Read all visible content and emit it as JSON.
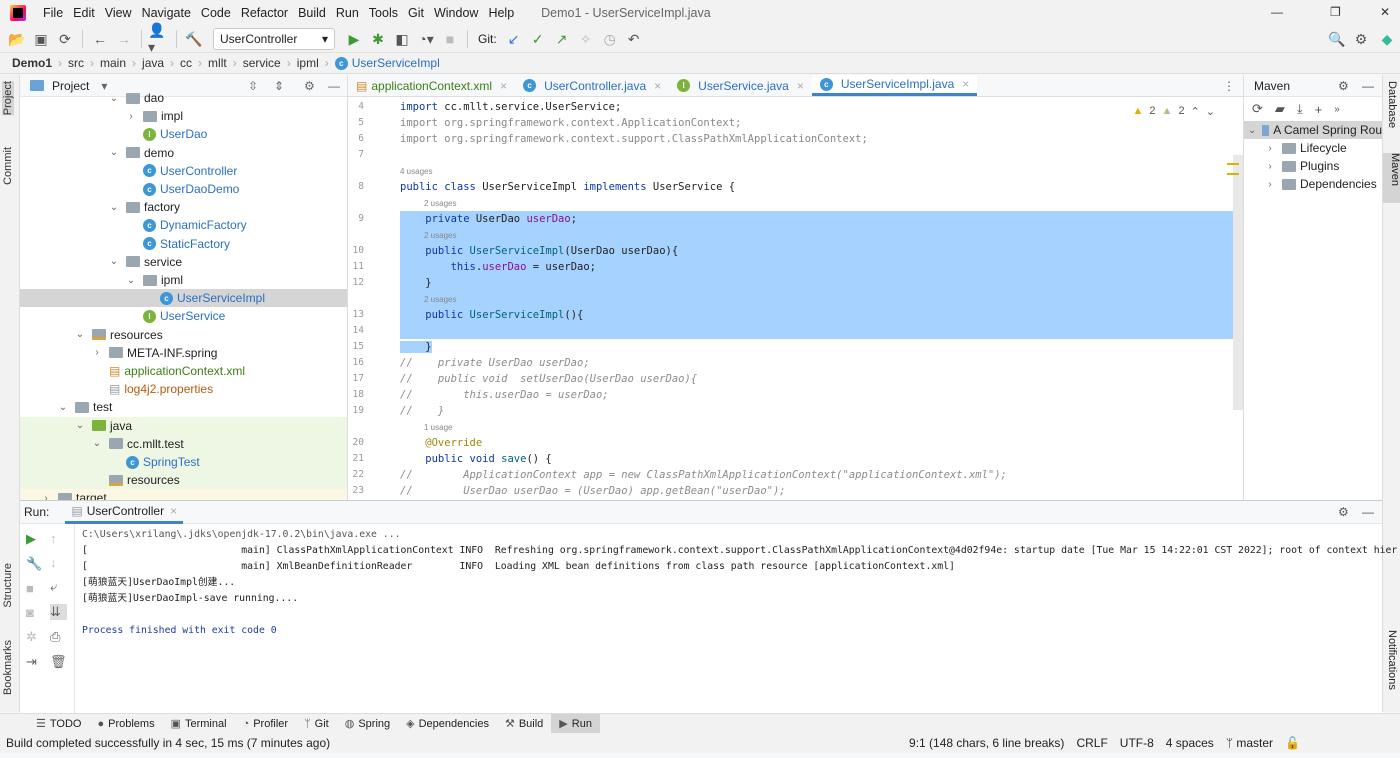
{
  "menu": {
    "items": [
      "File",
      "Edit",
      "View",
      "Navigate",
      "Code",
      "Refactor",
      "Build",
      "Run",
      "Tools",
      "Git",
      "Window",
      "Help"
    ],
    "title": "Demo1 - UserServiceImpl.java"
  },
  "toolbar": {
    "run_config": "UserController",
    "git_label": "Git:"
  },
  "breadcrumb": [
    "Demo1",
    "src",
    "main",
    "java",
    "cc",
    "mllt",
    "service",
    "ipml",
    "UserServiceImpl"
  ],
  "left_stripe": {
    "project": "Project",
    "commit": "Commit",
    "structure": "Structure",
    "bookmarks": "Bookmarks"
  },
  "project": {
    "title": "Project",
    "tree": [
      {
        "label": "dao",
        "type": "folder",
        "level": 5,
        "expanded": true
      },
      {
        "label": "impl",
        "type": "folder",
        "level": 6,
        "expanded": false
      },
      {
        "label": "UserDao",
        "type": "interface",
        "level": 6
      },
      {
        "label": "demo",
        "type": "folder",
        "level": 5,
        "expanded": true
      },
      {
        "label": "UserController",
        "type": "class",
        "level": 6
      },
      {
        "label": "UserDaoDemo",
        "type": "class",
        "level": 6
      },
      {
        "label": "factory",
        "type": "folder",
        "level": 5,
        "expanded": true
      },
      {
        "label": "DynamicFactory",
        "type": "class",
        "level": 6
      },
      {
        "label": "StaticFactory",
        "type": "class",
        "level": 6
      },
      {
        "label": "service",
        "type": "folder",
        "level": 5,
        "expanded": true
      },
      {
        "label": "ipml",
        "type": "folder",
        "level": 6,
        "expanded": true
      },
      {
        "label": "UserServiceImpl",
        "type": "class",
        "level": 7,
        "selected": true
      },
      {
        "label": "UserService",
        "type": "interface",
        "level": 6
      },
      {
        "label": "resources",
        "type": "res",
        "level": 3,
        "expanded": true
      },
      {
        "label": "META-INF.spring",
        "type": "folder",
        "level": 4,
        "expanded": false
      },
      {
        "label": "applicationContext.xml",
        "type": "xml",
        "level": 4
      },
      {
        "label": "log4j2.properties",
        "type": "props",
        "level": 4
      },
      {
        "label": "test",
        "type": "folder",
        "level": 2,
        "expanded": true
      },
      {
        "label": "java",
        "type": "src",
        "level": 3,
        "expanded": true,
        "highlight": true
      },
      {
        "label": "cc.mllt.test",
        "type": "folder",
        "level": 4,
        "expanded": true,
        "highlight": true
      },
      {
        "label": "SpringTest",
        "type": "class",
        "level": 5,
        "highlight": true
      },
      {
        "label": "resources",
        "type": "res",
        "level": 4,
        "highlight": true
      },
      {
        "label": "target",
        "type": "folder",
        "level": 1,
        "expanded": false
      }
    ]
  },
  "editor": {
    "tabs": [
      {
        "label": "applicationContext.xml",
        "type": "xml"
      },
      {
        "label": "UserController.java",
        "type": "class"
      },
      {
        "label": "UserService.java",
        "type": "interface"
      },
      {
        "label": "UserServiceImpl.java",
        "type": "class",
        "active": true
      }
    ],
    "warnings": "2",
    "weak_warnings": "2",
    "lines": [
      {
        "n": "4",
        "t": [
          [
            "import ",
            "kw"
          ],
          [
            "cc.mllt.service.UserService;",
            ""
          ]
        ]
      },
      {
        "n": "5",
        "t": [
          [
            "import org.springframework.context.ApplicationContext;",
            "gr"
          ]
        ]
      },
      {
        "n": "6",
        "t": [
          [
            "import org.springframework.context.support.ClassPathXmlApplicationContext;",
            "gr"
          ]
        ]
      },
      {
        "n": "7",
        "t": []
      },
      {
        "hint": "4 usages"
      },
      {
        "n": "8",
        "t": [
          [
            "public class ",
            "kw"
          ],
          [
            "UserServiceImpl ",
            ""
          ],
          [
            "implements ",
            "kw"
          ],
          [
            "UserService {",
            ""
          ]
        ]
      },
      {
        "hint": "2 usages",
        "indent": 1
      },
      {
        "n": "9",
        "sel": true,
        "t": [
          [
            "    private ",
            "kw"
          ],
          [
            "UserDao ",
            ""
          ],
          [
            "userDao",
            "fld"
          ],
          [
            ";",
            ""
          ]
        ]
      },
      {
        "hint": "2 usages",
        "indent": 1,
        "sel": true
      },
      {
        "n": "10",
        "sel": true,
        "t": [
          [
            "    public ",
            "kw"
          ],
          [
            "UserServiceImpl",
            "mt"
          ],
          [
            "(UserDao userDao){",
            ""
          ]
        ]
      },
      {
        "n": "11",
        "sel": true,
        "t": [
          [
            "        this",
            "kw"
          ],
          [
            ".",
            ""
          ],
          [
            "userDao",
            "fld"
          ],
          [
            " = userDao;",
            ""
          ]
        ]
      },
      {
        "n": "12",
        "sel": true,
        "t": [
          [
            "    }",
            ""
          ]
        ]
      },
      {
        "hint": "2 usages",
        "indent": 1,
        "sel": true
      },
      {
        "n": "13",
        "sel": true,
        "t": [
          [
            "    public ",
            "kw"
          ],
          [
            "UserServiceImpl",
            "mt"
          ],
          [
            "(){",
            ""
          ]
        ]
      },
      {
        "n": "14",
        "sel": true,
        "t": []
      },
      {
        "n": "15",
        "selpart": true,
        "t": [
          [
            "    }",
            ""
          ]
        ]
      },
      {
        "n": "16",
        "t": [
          [
            "//    private UserDao userDao;",
            "cm"
          ]
        ]
      },
      {
        "n": "17",
        "t": [
          [
            "//    public void  setUserDao(UserDao userDao){",
            "cm"
          ]
        ]
      },
      {
        "n": "18",
        "t": [
          [
            "//        this.userDao = userDao;",
            "cm"
          ]
        ]
      },
      {
        "n": "19",
        "t": [
          [
            "//    }",
            "cm"
          ]
        ]
      },
      {
        "hint": "1 usage",
        "indent": 1
      },
      {
        "n": "20",
        "t": [
          [
            "    @Override",
            "an"
          ]
        ]
      },
      {
        "n": "21",
        "t": [
          [
            "    public void ",
            "kw"
          ],
          [
            "save",
            "mt"
          ],
          [
            "() {",
            ""
          ]
        ]
      },
      {
        "n": "22",
        "t": [
          [
            "//        ApplicationContext app = new ClassPathXmlApplicationContext(\"applicationContext.xml\");",
            "cm"
          ]
        ]
      },
      {
        "n": "23",
        "t": [
          [
            "//        UserDao userDao = (UserDao) app.getBean(\"userDao\");",
            "cm"
          ]
        ]
      }
    ]
  },
  "maven": {
    "title": "Maven",
    "root": "A Camel Spring Rou",
    "items": [
      "Lifecycle",
      "Plugins",
      "Dependencies"
    ]
  },
  "right_stripe": {
    "database": "Database",
    "maven": "Maven",
    "notifications": "Notifications"
  },
  "run": {
    "label": "Run:",
    "tab": "UserController",
    "console": [
      {
        "text": "C:\\Users\\xrilang\\.jdks\\openjdk-17.0.2\\bin\\java.exe ...",
        "color": "#555"
      },
      {
        "text": "[                          main] ClassPathXmlApplicationContext INFO  Refreshing org.springframework.context.support.ClassPathXmlApplicationContext@4d02f94e: startup date [Tue Mar 15 14:22:01 CST 2022]; root of context hier",
        "color": "#222"
      },
      {
        "text": "[                          main] XmlBeanDefinitionReader        INFO  Loading XML bean definitions from class path resource [applicationContext.xml]",
        "color": "#222"
      },
      {
        "text": "[萌狼蓝天]UserDaoImpl创建...",
        "color": "#222"
      },
      {
        "text": "[萌狼蓝天]UserDaoImpl-save running....",
        "color": "#222"
      },
      {
        "text": "",
        "color": "#222"
      },
      {
        "text": "Process finished with exit code 0",
        "color": "#1e3ca0"
      }
    ]
  },
  "bottom_tabs": [
    "TODO",
    "Problems",
    "Terminal",
    "Profiler",
    "Git",
    "Spring",
    "Dependencies",
    "Build",
    "Run"
  ],
  "status": {
    "message": "Build completed successfully in 4 sec, 15 ms (7 minutes ago)",
    "position": "9:1 (148 chars, 6 line breaks)",
    "line_sep": "CRLF",
    "encoding": "UTF-8",
    "indent": "4 spaces",
    "branch": "master"
  }
}
